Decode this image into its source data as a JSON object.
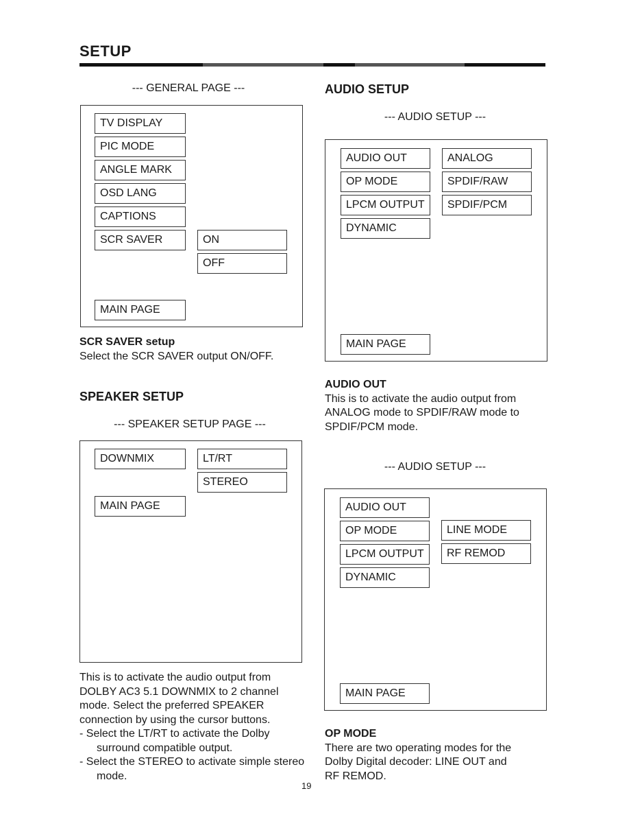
{
  "header": {
    "title": "SETUP"
  },
  "general": {
    "caption": "--- GENERAL PAGE ---",
    "menu": [
      "TV DISPLAY",
      "PIC MODE",
      "ANGLE MARK",
      "OSD LANG",
      "CAPTIONS",
      "SCR SAVER"
    ],
    "options": [
      "ON",
      "OFF"
    ],
    "main_page": "MAIN PAGE",
    "desc_title": "SCR SAVER setup",
    "desc_text": "Select the SCR SAVER output ON/OFF."
  },
  "speaker": {
    "heading": "SPEAKER SETUP",
    "caption": "--- SPEAKER SETUP PAGE ---",
    "menu": [
      "DOWNMIX"
    ],
    "options": [
      "LT/RT",
      "STEREO"
    ],
    "main_page": "MAIN PAGE",
    "desc_lines": [
      "This is to activate the audio output from",
      "DOLBY AC3 5.1 DOWNMIX to 2 channel",
      "mode.  Select the preferred SPEAKER",
      "connection by using the cursor buttons."
    ],
    "bullets": [
      "-  Select the LT/RT to activate the Dolby surround compatible output.",
      "-  Select the STEREO to activate simple stereo mode."
    ]
  },
  "audio": {
    "heading": "AUDIO SETUP",
    "caption1": "--- AUDIO SETUP ---",
    "menu": [
      "AUDIO OUT",
      "OP MODE",
      "LPCM OUTPUT",
      "DYNAMIC"
    ],
    "audio_out_options": [
      "ANALOG",
      "SPDIF/RAW",
      "SPDIF/PCM"
    ],
    "main_page": "MAIN PAGE",
    "desc1_title": "AUDIO OUT",
    "desc1_lines": [
      "This is to activate the audio output from",
      "ANALOG mode to SPDIF/RAW mode to",
      "SPDIF/PCM mode."
    ],
    "caption2": "--- AUDIO SETUP ---",
    "op_mode_options": [
      "LINE MODE",
      "RF REMOD"
    ],
    "desc2_title": "OP MODE",
    "desc2_lines": [
      "There are two operating modes for the",
      "Dolby Digital decoder:  LINE OUT and",
      "RF REMOD."
    ]
  },
  "footer": {
    "page_number": "19"
  }
}
